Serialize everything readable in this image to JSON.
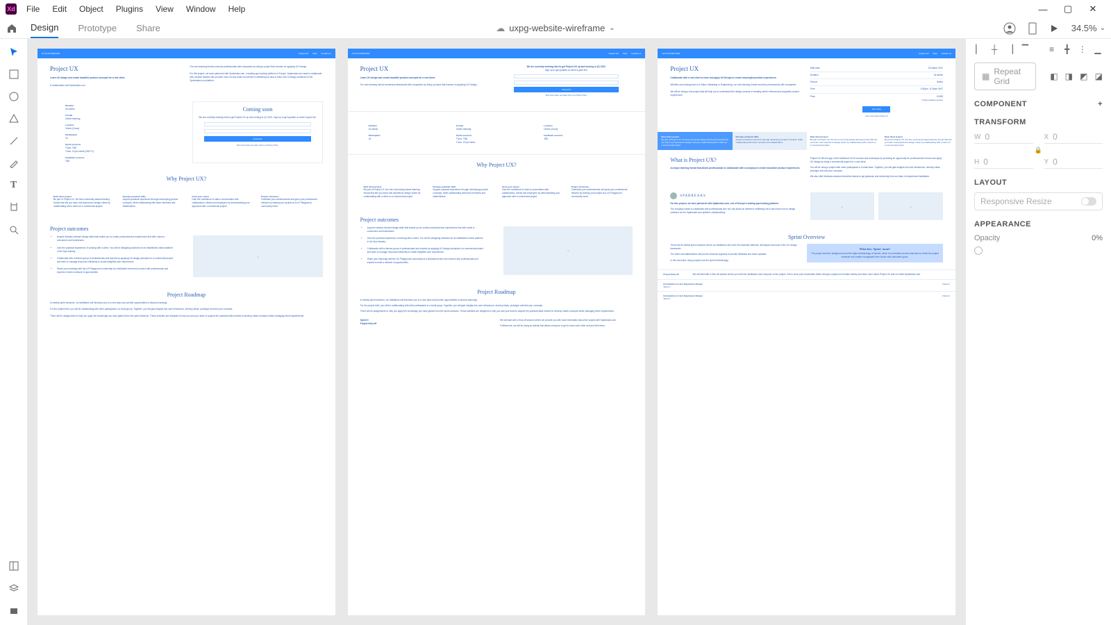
{
  "menu": {
    "file": "File",
    "edit": "Edit",
    "object": "Object",
    "plugins": "Plugins",
    "view": "View",
    "window": "Window",
    "help": "Help"
  },
  "modes": {
    "design": "Design",
    "prototype": "Prototype",
    "share": "Share"
  },
  "doc": {
    "name": "uxpg-website-wireframe",
    "zoom": "34.5%"
  },
  "panel": {
    "repeat_grid": "Repeat Grid",
    "component": "COMPONENT",
    "transform": "TRANSFORM",
    "w": "W",
    "wv": "0",
    "x": "X",
    "xv": "0",
    "h": "H",
    "hv": "0",
    "y": "Y",
    "yv": "0",
    "layout": "LAYOUT",
    "resize": "Responsive Resize",
    "appearance": "APPEARANCE",
    "opacity": "Opacity",
    "opacity_val": "0%"
  },
  "nav": {
    "brand": "UX PLAYGROUND",
    "l1": "Project UX",
    "l2": "FAQ",
    "l3": "Contact us"
  },
  "ab1": {
    "title": "Project UX",
    "sub": "Learn UX design and create beautiful product concepts for a real client.",
    "partner": "A collaboration with Spabreaks.com",
    "intro1": "Our new learning format connects professionals with companies by doing a project that focuses on applying UX Design.",
    "intro2": "For this project, we have partnered with Spabreaks.com, a leading spa booking platform in Europe. Spabreaks.com want to collaborate with creative thinkers like yourself, who not only share an interest in wellbeing but also to learn how to design solutions for the Spabreaks.com platform.",
    "duration_l": "Duration",
    "duration_v": "16 weeks",
    "format_l": "Format",
    "format_v": "Online learning",
    "location_l": "Location",
    "location_v": "Online (Zoom)",
    "participants_l": "Participants",
    "participants_v": "16",
    "sprint_l": "Sprint sessions",
    "sprint_v1": "Thurs. TBD",
    "sprint_v2": "Thurs. 20 per week (GMT+1)",
    "feedback_l": "Feedback sessions",
    "feedback_v": "TBD",
    "soon_title": "Coming soon",
    "soon_txt": "We are currently working hard to get Project UX up and running in Q1 2021. Sign up to get updates on when it goes live.",
    "soon_btn": "Subscribe",
    "why_title": "Why Project UX?",
    "c1t": "Real client project",
    "c1b": "Be part of Project UX, the free community-based learning format that lets you learn real experience design online by collaborating with a client on a commercial project.",
    "c2t": "Develop practical skills",
    "c2b": "Acquire practical experience through developing product concepts, while collaborating with team members and stakeholders.",
    "c3t": "Grow your career",
    "c3b": "Gain the confidence to start a conversation with collaborators, clients and employers by demonstrating your approach with a commercial project.",
    "c4t": "Project showcase",
    "c4b": "Celebrate your achievements and grow your professional network by sharing your project at a UX Playground community event.",
    "outcomes_title": "Project outcomes",
    "o1": "Acquire industry relevant design skills that enable you to create product/service experiences that offer value to consumers and businesses.",
    "o2": "Gain the practical experience of working with a client. You will be designing solutions for an established online platform in the Spa industry.",
    "o3": "Collaborate with a diverse group of professionals and experts by applying UX design principles to a commercial project and learn to manage resources efficiently to create delightful user experiences.",
    "o4": "Share your learnings with the UX Playground community at a dedicated event and connect with professionals and experts to build a network of opportunities.",
    "roadmap_title": "Project Roadmap",
    "r1": "In weekly sprint sessions, our facilitators will introduce you to a new topic and provide opportunities to discuss learnings.",
    "r2": "For the project brief, you will be collaborating with other participants in a small group. Together, you will gain insights into user behaviours, develop ideas, prototype and test your concepts.",
    "r3": "There will be assignments to help you apply the knowledge you have gained from the sprint sessions. These activities are designed to help you and your team to acquire the practical skills needed to develop viable concepts whilst managing client requirements."
  },
  "ab2": {
    "title": "Project UX",
    "sub": "Learn UX design and create beautiful product concepts for a real client.",
    "intro": "Our new learning format connects professionals with companies by doing a project that focuses on applying UX Design.",
    "banner_t": "We are currently working hard to get Project UX up and running in Q1 2021.",
    "banner_s": "Sign up to get updates on when it goes live.",
    "btn": "Subscribe",
    "duration_l": "Duration",
    "duration_v": "16 weeks",
    "format_l": "Format",
    "format_v": "Online learning",
    "location_l": "Location",
    "location_v": "Online (Zoom)",
    "participants_l": "Participants",
    "participants_v": "16",
    "sprint_l": "Sprint sessions",
    "sprint_v1": "Thurs. TBD",
    "sprint_v2": "Thurs. 20 per week",
    "feedback_l": "Feedback sessions",
    "feedback_v": "TBD",
    "why_title": "Why Project UX?",
    "outcomes_title": "Project outcomes",
    "roadmap_title": "Project Roadmap",
    "sprint0": "Sprint 0",
    "kickoff": "Project Kick-off",
    "r4a": "We will start with a Kick-off session where we provide you with more information about the project with Spabreaks.com.",
    "r4b": "Furthermore, we will be doing an activity that allows everyone to get to know each other and join their team."
  },
  "ab3": {
    "title": "Project UX",
    "sub": "Collaborate with a real client to learn and apply UX Design to create meaningful product experiences.",
    "p1": "Whether your background is in Sales, Marketing or Engineering, our new learning format connects professionals with companies.",
    "p2": "We will be doing a real project that will help you to understand the design process of creating useful, relevant and enjoyable product experiences.",
    "start_l": "Start date",
    "start_v": "03 March 2021",
    "dur_l": "Duration",
    "dur_v": "16 weeks",
    "fmt_l": "Format",
    "fmt_v": "Online",
    "time_l": "Time",
    "time_v": "6:30pm - 8:30pm GMT",
    "price_l": "Price",
    "price_v": "£2499",
    "price_note": "Includes feedback sessions",
    "cta": "Join today",
    "cta_sub": "Learn more about Project UX",
    "what_title": "What is Project UX?",
    "what_sub": "A unique learning format that allows professionals to collaborate with a company to create innovative product experiences.",
    "d1": "Project UX fills the gap of the traditional UX/UI courses and bootcamps by providing an opportunity for professionals to learn and apply UX design by doing a commercial project for a real client.",
    "d2": "You will be doing a project with other participants in a small team. Together, you will gain insights into user behaviours, develop ideas, prototype and test your concepts.",
    "d3": "We also offer feedback sessions that allow teams to get guidance and mentoring from our team of experienced facilitators.",
    "spa_name": "SPABREAKS",
    "spa_t": "For this project, we have partnered with Spabreaks.com, one of Europe's leading spa booking platform.",
    "spa_b": "The company wants to collaborate with professionals who not only share an interest in wellbeing but to also learn how to design solutions for the Spabreaks.com platform collaboratively.",
    "sprint_title": "Sprint Overview",
    "s1": "There will be weekly sprint sessions where our facilitators will cover the essential methods, techniques and tools of the UX design framework.",
    "s2": "The client and stakeholders will join the sessions regularly to provide feedback and share updates.",
    "s3": "In the real world, many projects use the sprint methodology.",
    "box_t": "What does 'Sprint' mean?",
    "box_b": "The project format is designed around the Agile methodology of Sprints, which is an iterative process that aims to break the project schedule into smaller manageable time blocks with actionable goals.",
    "r0t": "Project Kick-off",
    "r0b": "We will start with a Kick-off session where you meet the facilitators and everyone on the project. Get to know your teammates better through a playful ice breaker activity and learn more about Project UX and our client Spabreaks.com.",
    "r1t": "Introduction to User Experience Design",
    "r1s": "Sprint 1",
    "chev": "Chevron",
    "r2t": "Introduction to User Experience Design",
    "r2s": "Sprint 1"
  }
}
